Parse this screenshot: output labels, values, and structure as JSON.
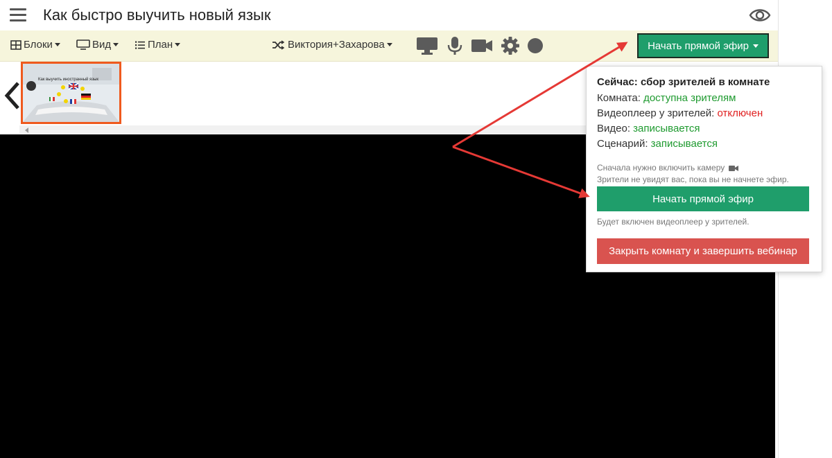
{
  "header": {
    "title": "Как быстро выучить новый язык"
  },
  "toolbar": {
    "blocks_label": "Блоки",
    "view_label": "Вид",
    "plan_label": "План",
    "speaker_label": "Виктория+Захарова",
    "start_live_label": "Начать прямой эфир"
  },
  "thumbnail": {
    "text": "Как выучить иностранный язык"
  },
  "popup": {
    "heading": "Сейчас: сбор зрителей в комнате",
    "room_label": "Комната: ",
    "room_value": "доступна зрителям",
    "player_label": "Видеоплеер у зрителей: ",
    "player_value": "отключен",
    "video_label": "Видео: ",
    "video_value": "записывается",
    "script_label": "Сценарий: ",
    "script_value": "записывается",
    "note1": "Сначала нужно включить камеру",
    "note2": "Зрители не увидят вас, пока вы не начнете эфир.",
    "start_button": "Начать прямой эфир",
    "note3": "Будет включен видеоплеер у зрителей.",
    "close_button": "Закрыть комнату и завершить вебинар"
  },
  "icons": [
    "menu-icon",
    "eye-icon",
    "blocks-icon",
    "monitor-icon",
    "list-icon",
    "shuffle-icon",
    "screen-share-icon",
    "microphone-icon",
    "camera-icon",
    "gear-icon",
    "record-icon",
    "chevron-left-icon"
  ],
  "colors": {
    "accent_green": "#1f9e6b",
    "danger_red": "#d9534f",
    "toolbar_bg": "#f6f5dc",
    "status_green": "#1e9a2f",
    "status_red": "#e02020",
    "arrow_red": "#e53935",
    "thumb_border": "#ef5a1e"
  }
}
